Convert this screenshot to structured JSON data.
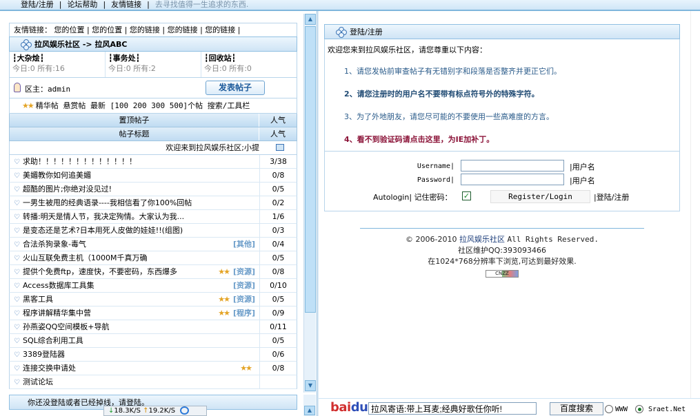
{
  "topnav": {
    "items": [
      "登陆/注册",
      "论坛帮助",
      "友情链接"
    ],
    "tip": "去寻找值得一生追求的东西."
  },
  "left": {
    "links_label": "友情链接：",
    "links": [
      "您的位置",
      "您的位置",
      "您的链接",
      "您的链接",
      "您的链接"
    ],
    "breadcrumb": "拉风娱乐社区  -> 拉风ABC",
    "boards": [
      {
        "name": "大杂烩",
        "today": "今日:0",
        "total": "所有:16"
      },
      {
        "name": "事务处",
        "today": "今日:0",
        "total": "所有:2"
      },
      {
        "name": "回收站",
        "today": "今日:0",
        "total": "所有:0"
      }
    ],
    "moderator": "区主：admin",
    "post_button": "发表帖子",
    "filters": "精华帖  悬赏帖  最新 [100 200 300 500]个帖  搜索/工具栏",
    "pinned_header": "置顶帖子",
    "popularity_header": "人气",
    "title_header": "帖子标题",
    "welcome_scroll": "欢迎来到拉风娱乐社区;小提",
    "threads": [
      {
        "title": "求助！！！！！！！！！！！！！",
        "tag": "",
        "stars": false,
        "pop": "3/38"
      },
      {
        "title": "美媚教你如何追美媚",
        "tag": "",
        "stars": false,
        "pop": "0/8"
      },
      {
        "title": "超酷的图片;你绝对没见过!",
        "tag": "",
        "stars": false,
        "pop": "0/5"
      },
      {
        "title": "一男生被甩的经典语录----我相信看了你100%回帖",
        "tag": "",
        "stars": false,
        "pop": "0/2"
      },
      {
        "title": "转播:明天是情人节，我决定殉情。大家认为我...",
        "tag": "",
        "stars": false,
        "pop": "1/6"
      },
      {
        "title": "是变态还是艺术?日本用死人皮做的娃娃!!(组图)",
        "tag": "",
        "stars": false,
        "pop": "0/3"
      },
      {
        "title": "合法杀狗录象-毒气",
        "tag": "[其他]",
        "stars": false,
        "pop": "0/4"
      },
      {
        "title": "火山互联免费主机（1000M千真万确",
        "tag": "",
        "stars": false,
        "pop": "0/5"
      },
      {
        "title": "提供个免费ftp，速度快，不要密码，东西爆多",
        "tag": "[资源]",
        "stars": true,
        "pop": "0/8"
      },
      {
        "title": "Access数据库工具集",
        "tag": "[资源]",
        "stars": false,
        "pop": "0/10"
      },
      {
        "title": "黑客工具",
        "tag": "[资源]",
        "stars": true,
        "pop": "0/5"
      },
      {
        "title": "程序讲解精华集中营",
        "tag": "[程序]",
        "stars": true,
        "pop": "0/9"
      },
      {
        "title": "孙燕姿QQ空间模板+导航",
        "tag": "",
        "stars": false,
        "pop": "0/11"
      },
      {
        "title": "SQL综合利用工具",
        "tag": "",
        "stars": false,
        "pop": "0/5"
      },
      {
        "title": "3389登陆器",
        "tag": "",
        "stars": false,
        "pop": "0/6"
      },
      {
        "title": "连接交换申请处",
        "tag": "",
        "stars": true,
        "pop": "0/8"
      },
      {
        "title": "测试论坛",
        "tag": "",
        "stars": false,
        "pop": ""
      }
    ],
    "bottom_notice": "你还没登陆或者已经掉线，请登陆。",
    "speed_down": "18.3K/S",
    "speed_up": "19.2K/S"
  },
  "right": {
    "header": "登陆/注册",
    "intro": "欢迎您来到拉风娱乐社区，请您尊重以下内容：",
    "rules": [
      "1、请您发帖前审查帖子有无错别字和段落是否整齐并更正它们。",
      "2、请您注册时的用户名不要带有标点符号外的特殊字符。",
      "3、为了外地朋友，请您尽可能的不要使用一些高难度的方言。",
      "4、看不到验证码请点击这里，为IE加补丁。"
    ],
    "username_label": "Username|",
    "username_value": "",
    "username_suffix": "|用户名",
    "password_label": "Password|",
    "password_value": "",
    "password_suffix": "|用户名",
    "autologin_label": "Autologin| 记住密码：",
    "autologin_checked": "✓",
    "register_button": "Register/Login",
    "login_suffix": "|登陆/注册",
    "footer_copyright": "© 2006-2010",
    "footer_site": "拉风娱乐社区",
    "footer_rights": "All Rights Reserved.",
    "footer_qq": "社区维护QQ:393093466",
    "footer_resolution": "在1024*768分辨率下浏览,可达到最好效果.",
    "footer_badge": "CNZZ"
  },
  "baidu": {
    "logo_a": "bai",
    "logo_b": "du",
    "search_value": "拉风寄语:带上耳麦;经典好歌任你听!",
    "search_button": "百度搜索",
    "option_www": "WWW",
    "option_site": "Sraet.Net"
  }
}
